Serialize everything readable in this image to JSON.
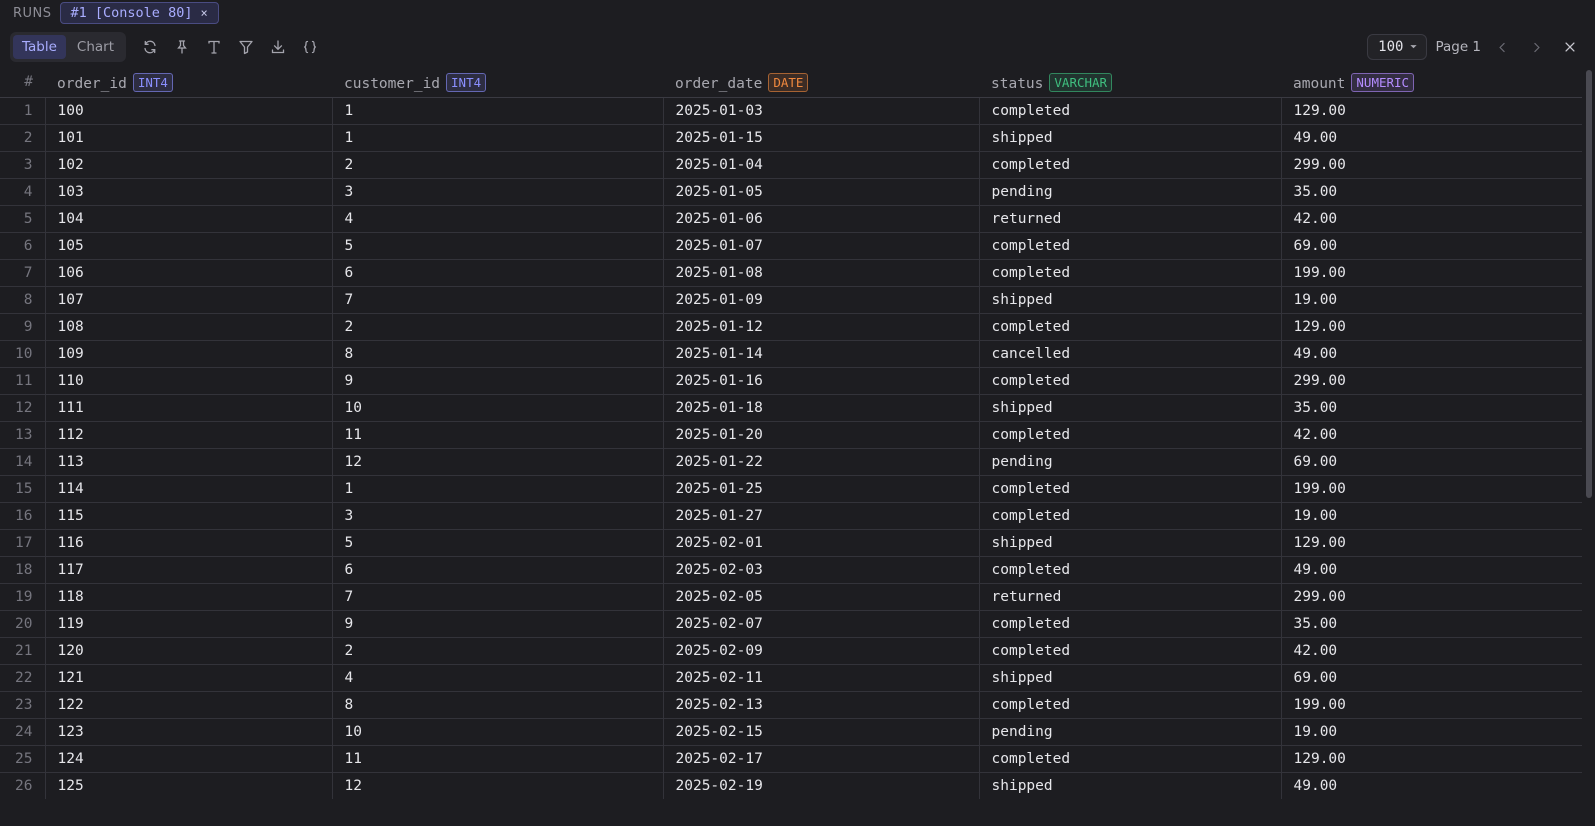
{
  "runs": {
    "label": "RUNS",
    "tab_label": "#1 [Console 80]",
    "close_glyph": "×"
  },
  "toolbar": {
    "views": [
      "Table",
      "Chart"
    ],
    "active_view": "Table",
    "icons": [
      "refresh-icon",
      "pin-icon",
      "text-format-icon",
      "filter-icon",
      "download-icon",
      "json-braces-icon"
    ],
    "rows_per_page": "100",
    "page_label": "Page 1"
  },
  "colors": {
    "int4": "#8a8fff",
    "date": "#f0883e",
    "varchar": "#3fbf7f",
    "numeric": "#b48cff"
  },
  "table": {
    "row_num_header": "#",
    "columns": [
      {
        "name": "order_id",
        "type": "INT4",
        "type_color": "#8a8fff"
      },
      {
        "name": "customer_id",
        "type": "INT4",
        "type_color": "#8a8fff"
      },
      {
        "name": "order_date",
        "type": "DATE",
        "type_color": "#f0883e"
      },
      {
        "name": "status",
        "type": "VARCHAR",
        "type_color": "#3fbf7f"
      },
      {
        "name": "amount",
        "type": "NUMERIC",
        "type_color": "#b48cff"
      }
    ],
    "rows": [
      [
        "100",
        "1",
        "2025-01-03",
        "completed",
        "129.00"
      ],
      [
        "101",
        "1",
        "2025-01-15",
        "shipped",
        "49.00"
      ],
      [
        "102",
        "2",
        "2025-01-04",
        "completed",
        "299.00"
      ],
      [
        "103",
        "3",
        "2025-01-05",
        "pending",
        "35.00"
      ],
      [
        "104",
        "4",
        "2025-01-06",
        "returned",
        "42.00"
      ],
      [
        "105",
        "5",
        "2025-01-07",
        "completed",
        "69.00"
      ],
      [
        "106",
        "6",
        "2025-01-08",
        "completed",
        "199.00"
      ],
      [
        "107",
        "7",
        "2025-01-09",
        "shipped",
        "19.00"
      ],
      [
        "108",
        "2",
        "2025-01-12",
        "completed",
        "129.00"
      ],
      [
        "109",
        "8",
        "2025-01-14",
        "cancelled",
        "49.00"
      ],
      [
        "110",
        "9",
        "2025-01-16",
        "completed",
        "299.00"
      ],
      [
        "111",
        "10",
        "2025-01-18",
        "shipped",
        "35.00"
      ],
      [
        "112",
        "11",
        "2025-01-20",
        "completed",
        "42.00"
      ],
      [
        "113",
        "12",
        "2025-01-22",
        "pending",
        "69.00"
      ],
      [
        "114",
        "1",
        "2025-01-25",
        "completed",
        "199.00"
      ],
      [
        "115",
        "3",
        "2025-01-27",
        "completed",
        "19.00"
      ],
      [
        "116",
        "5",
        "2025-02-01",
        "shipped",
        "129.00"
      ],
      [
        "117",
        "6",
        "2025-02-03",
        "completed",
        "49.00"
      ],
      [
        "118",
        "7",
        "2025-02-05",
        "returned",
        "299.00"
      ],
      [
        "119",
        "9",
        "2025-02-07",
        "completed",
        "35.00"
      ],
      [
        "120",
        "2",
        "2025-02-09",
        "completed",
        "42.00"
      ],
      [
        "121",
        "4",
        "2025-02-11",
        "shipped",
        "69.00"
      ],
      [
        "122",
        "8",
        "2025-02-13",
        "completed",
        "199.00"
      ],
      [
        "123",
        "10",
        "2025-02-15",
        "pending",
        "19.00"
      ],
      [
        "124",
        "11",
        "2025-02-17",
        "completed",
        "129.00"
      ],
      [
        "125",
        "12",
        "2025-02-19",
        "shipped",
        "49.00"
      ]
    ]
  }
}
